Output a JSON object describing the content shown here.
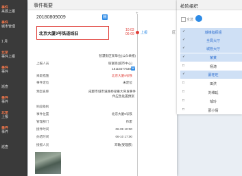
{
  "background_list": {
    "items": [
      {
        "tag": "事件",
        "text": "来源上报"
      },
      {
        "tag": "事件",
        "text": "城市管理"
      },
      {
        "tag": "",
        "text": "1 月"
      },
      {
        "tag": "北京",
        "text": "事件上报"
      },
      {
        "tag": "事件",
        "text": "事件"
      },
      {
        "tag": "",
        "text": "巡查"
      },
      {
        "tag": "事件",
        "text": "事件"
      },
      {
        "tag": "北京",
        "text": "上报"
      },
      {
        "tag": "事件",
        "text": "事件"
      },
      {
        "tag": "",
        "text": "巡查"
      }
    ]
  },
  "event_dialog": {
    "title": "事件概要",
    "event_no": "20180809009",
    "address": "北京大厦9号铁道线旧",
    "reporter_org": "智慧街区某单位(公众举报)",
    "fields": [
      {
        "label": "上报人员",
        "value": "张富晓(城市中心)"
      },
      {
        "label": "",
        "value": "18115577638"
      },
      {
        "label": "采取措施",
        "value": "北京大厦9号铁"
      },
      {
        "label": "事件定位",
        "value": "未定位"
      },
      {
        "label": "预案名称",
        "value": "成都市城市道路桥梁重大突发事件"
      },
      {
        "label": "",
        "value": "件应急处置预案"
      },
      {
        "label": "响应级别",
        "value": ""
      },
      {
        "label": "事件位置",
        "value": "北京大厦9号铁"
      },
      {
        "label": "管理部门",
        "value": "作废"
      },
      {
        "label": "接件时间",
        "value": "06-09 10:00"
      },
      {
        "label": "办结时间",
        "value": "06-10 17:00"
      },
      {
        "label": "接报人员",
        "value": "邓敏(受理部)"
      }
    ],
    "timeline": {
      "top_marker": "+",
      "time_line1": "10:03",
      "time_line2": "06-09",
      "label": "上报",
      "right_label": "区"
    }
  },
  "org_panel": {
    "title": "抢险组织",
    "select_all_label": "全选",
    "rows": [
      {
        "label": "城维指挥组",
        "selected": true,
        "checked": true
      },
      {
        "label": "全局大厅",
        "selected": true,
        "checked": true
      },
      {
        "label": "城管大厅",
        "selected": true,
        "checked": true
      },
      {
        "label": "某某",
        "selected": true,
        "checked": true
      },
      {
        "label": "杨涛",
        "selected": false,
        "checked": false
      },
      {
        "label": "蒙旺旺",
        "selected": true,
        "checked": true
      },
      {
        "label": "田洪",
        "selected": false,
        "checked": false
      },
      {
        "label": "刘维廷",
        "selected": false,
        "checked": false
      },
      {
        "label": "邹玲",
        "selected": false,
        "checked": false
      },
      {
        "label": "邵小倩",
        "selected": false,
        "checked": false
      }
    ]
  },
  "colors": {
    "accent": "#2e8be6",
    "alert": "#e0403a",
    "selected_row": "#cfe0f5"
  }
}
